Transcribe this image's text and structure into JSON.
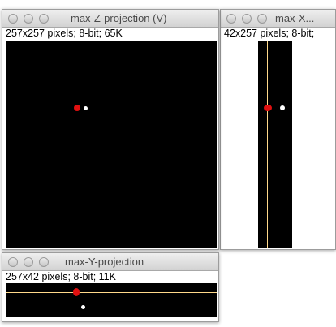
{
  "windows": {
    "z_projection": {
      "title": "max-Z-projection (V)",
      "info": "257x257 pixels; 8-bit; 65K"
    },
    "x_projection": {
      "title": "max-X...",
      "info": "42x257 pixels; 8-bit;"
    },
    "y_projection": {
      "title": "max-Y-projection",
      "info": "257x42 pixels; 8-bit; 11K"
    }
  },
  "colors": {
    "canvas": "#000000",
    "red_marker": "#e01010",
    "white_marker": "#ffffff",
    "crosshair": "#ffd98a"
  }
}
